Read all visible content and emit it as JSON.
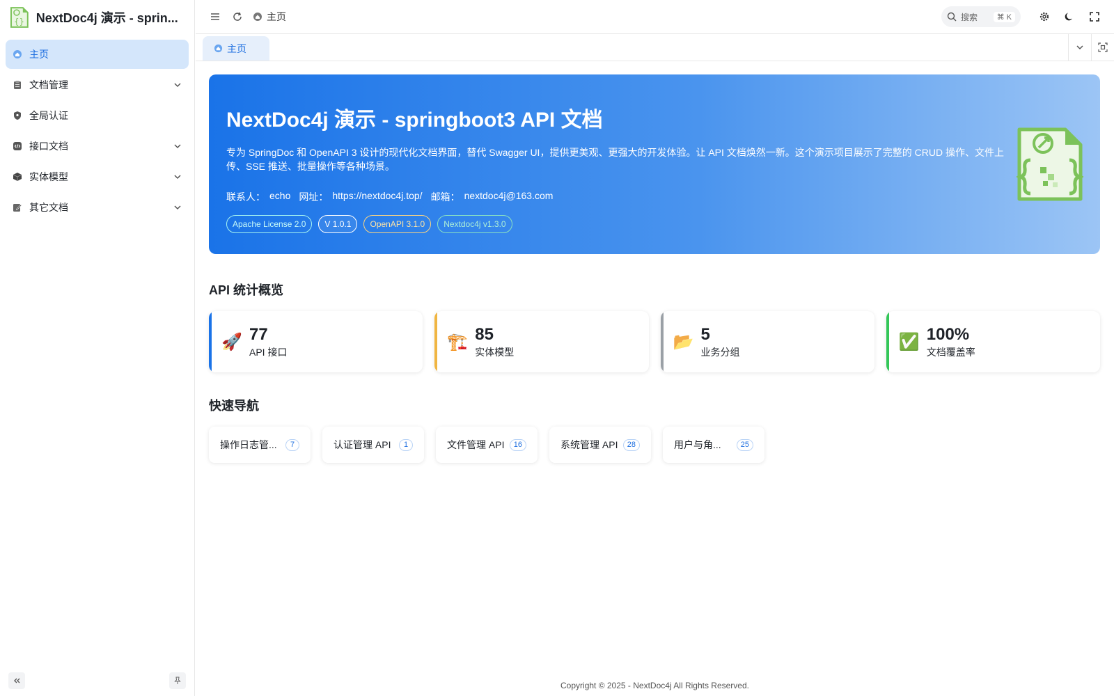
{
  "app": {
    "title": "NextDoc4j 演示 - springboot3 API 文档",
    "title_display": "NextDoc4j 演示 - sprin..."
  },
  "sidebar": {
    "items": [
      {
        "label": "主页",
        "icon": "home-icon",
        "active": true,
        "expandable": false
      },
      {
        "label": "文档管理",
        "icon": "clipboard-icon",
        "active": false,
        "expandable": true
      },
      {
        "label": "全局认证",
        "icon": "shield-icon",
        "active": false,
        "expandable": false
      },
      {
        "label": "接口文档",
        "icon": "code-icon",
        "active": false,
        "expandable": true
      },
      {
        "label": "实体模型",
        "icon": "cube-icon",
        "active": false,
        "expandable": true
      },
      {
        "label": "其它文档",
        "icon": "edit-icon",
        "active": false,
        "expandable": true
      }
    ]
  },
  "header": {
    "breadcrumb": "主页",
    "search_placeholder": "搜索",
    "search_shortcut": "⌘ K"
  },
  "tabs": [
    {
      "label": "主页"
    }
  ],
  "hero": {
    "title": "NextDoc4j 演示 - springboot3 API 文档",
    "description": "专为 SpringDoc 和 OpenAPI 3 设计的现代化文档界面，替代 Swagger UI，提供更美观、更强大的开发体验。让 API 文档焕然一新。这个演示项目展示了完整的 CRUD 操作、文件上传、SSE 推送、批量操作等各种场景。",
    "contact_label": "联系人：",
    "contact_name": "echo",
    "site_label": "网址：",
    "site_url": "https://nextdoc4j.top/",
    "email_label": "邮箱：",
    "email": "nextdoc4j@163.com",
    "badges": [
      "Apache License 2.0",
      "V 1.0.1",
      "OpenAPI 3.1.0",
      "Nextdoc4j v1.3.0"
    ]
  },
  "stats": {
    "title": "API 统计概览",
    "items": [
      {
        "emoji": "🚀",
        "value": "77",
        "label": "API 接口",
        "accent": "#1a73e8"
      },
      {
        "emoji": "🏗️",
        "value": "85",
        "label": "实体模型",
        "accent": "#f0b541"
      },
      {
        "emoji": "📂",
        "value": "5",
        "label": "业务分组",
        "accent": "#9aa0a6"
      },
      {
        "emoji": "✅",
        "value": "100%",
        "label": "文档覆盖率",
        "accent": "#34c759"
      }
    ]
  },
  "quick_nav": {
    "title": "快速导航",
    "items": [
      {
        "label": "操作日志管...",
        "count": "7"
      },
      {
        "label": "认证管理 API",
        "count": "1"
      },
      {
        "label": "文件管理 API",
        "count": "16"
      },
      {
        "label": "系统管理 API",
        "count": "28"
      },
      {
        "label": "用户与角...",
        "count": "25"
      }
    ]
  },
  "footer": {
    "text": "Copyright © 2025 - NextDoc4j All Rights Reserved."
  }
}
